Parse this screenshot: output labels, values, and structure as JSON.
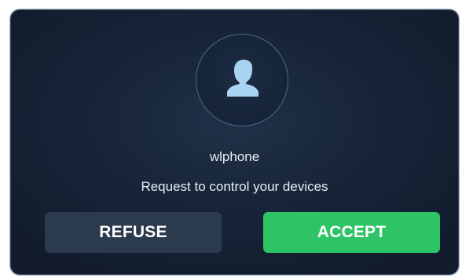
{
  "dialog": {
    "username": "wlphone",
    "message": "Request to control your devices",
    "avatar_icon": "user-silhouette-icon",
    "refuse_label": "REFUSE",
    "accept_label": "ACCEPT"
  },
  "colors": {
    "background": "#18253a",
    "border": "#2f4b63",
    "refuse": "#2c3a4e",
    "accept": "#2ec365",
    "avatar_icon": "#a9d3f2",
    "text": "#e9eef4"
  }
}
